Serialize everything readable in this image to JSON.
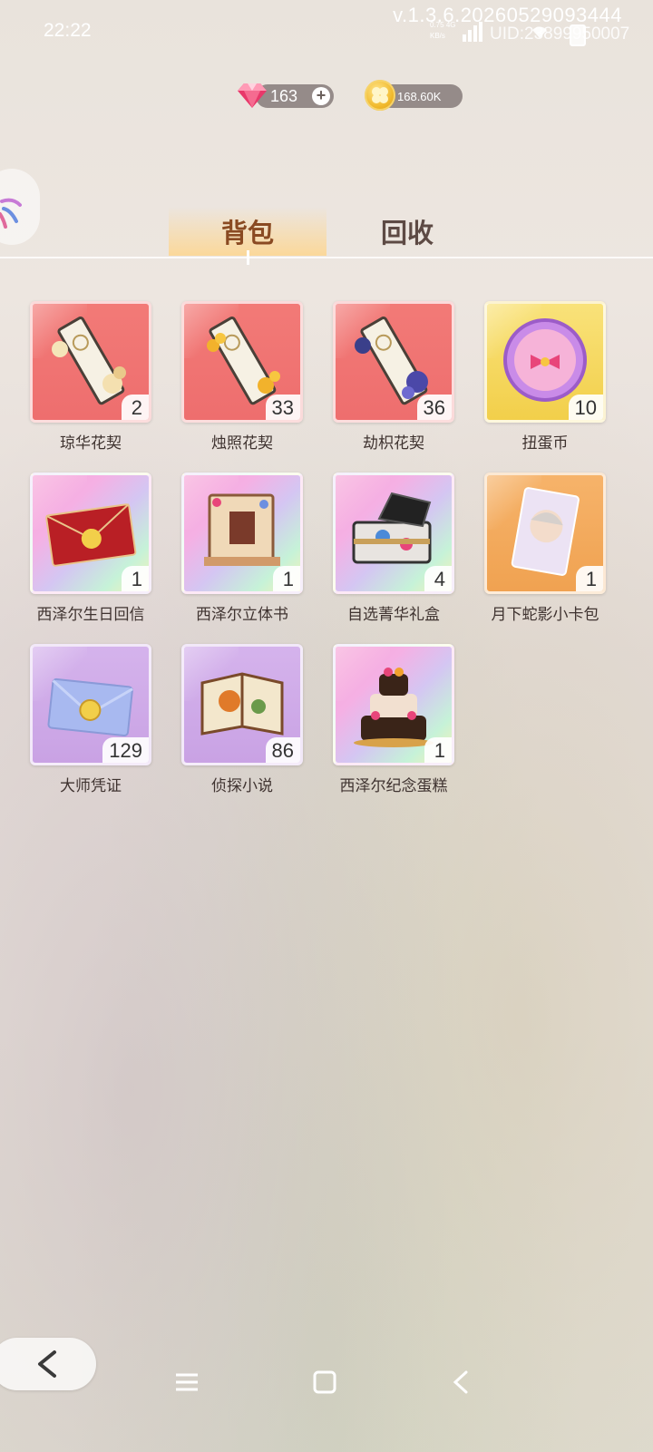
{
  "status_bar": {
    "time": "22:22",
    "version": "v.1.3.6.20260529093444",
    "net_speed": "0.75",
    "net_type": "4G",
    "net_unit": "KB/s",
    "uid": "UID:23899950007"
  },
  "currency": {
    "gems": "163",
    "coins": "168.60K"
  },
  "tabs": {
    "backpack": "背包",
    "recycle": "回收"
  },
  "items": [
    {
      "name": "琼华花契",
      "count": "2"
    },
    {
      "name": "烛照花契",
      "count": "33"
    },
    {
      "name": "劫枳花契",
      "count": "36"
    },
    {
      "name": "扭蛋币",
      "count": "10"
    },
    {
      "name": "西泽尔生日回信",
      "count": "1"
    },
    {
      "name": "西泽尔立体书",
      "count": "1"
    },
    {
      "name": "自选菁华礼盒",
      "count": "4"
    },
    {
      "name": "月下蛇影小卡包",
      "count": "1"
    },
    {
      "name": "大师凭证",
      "count": "129"
    },
    {
      "name": "侦探小说",
      "count": "86"
    },
    {
      "name": "西泽尔纪念蛋糕",
      "count": "1"
    }
  ]
}
